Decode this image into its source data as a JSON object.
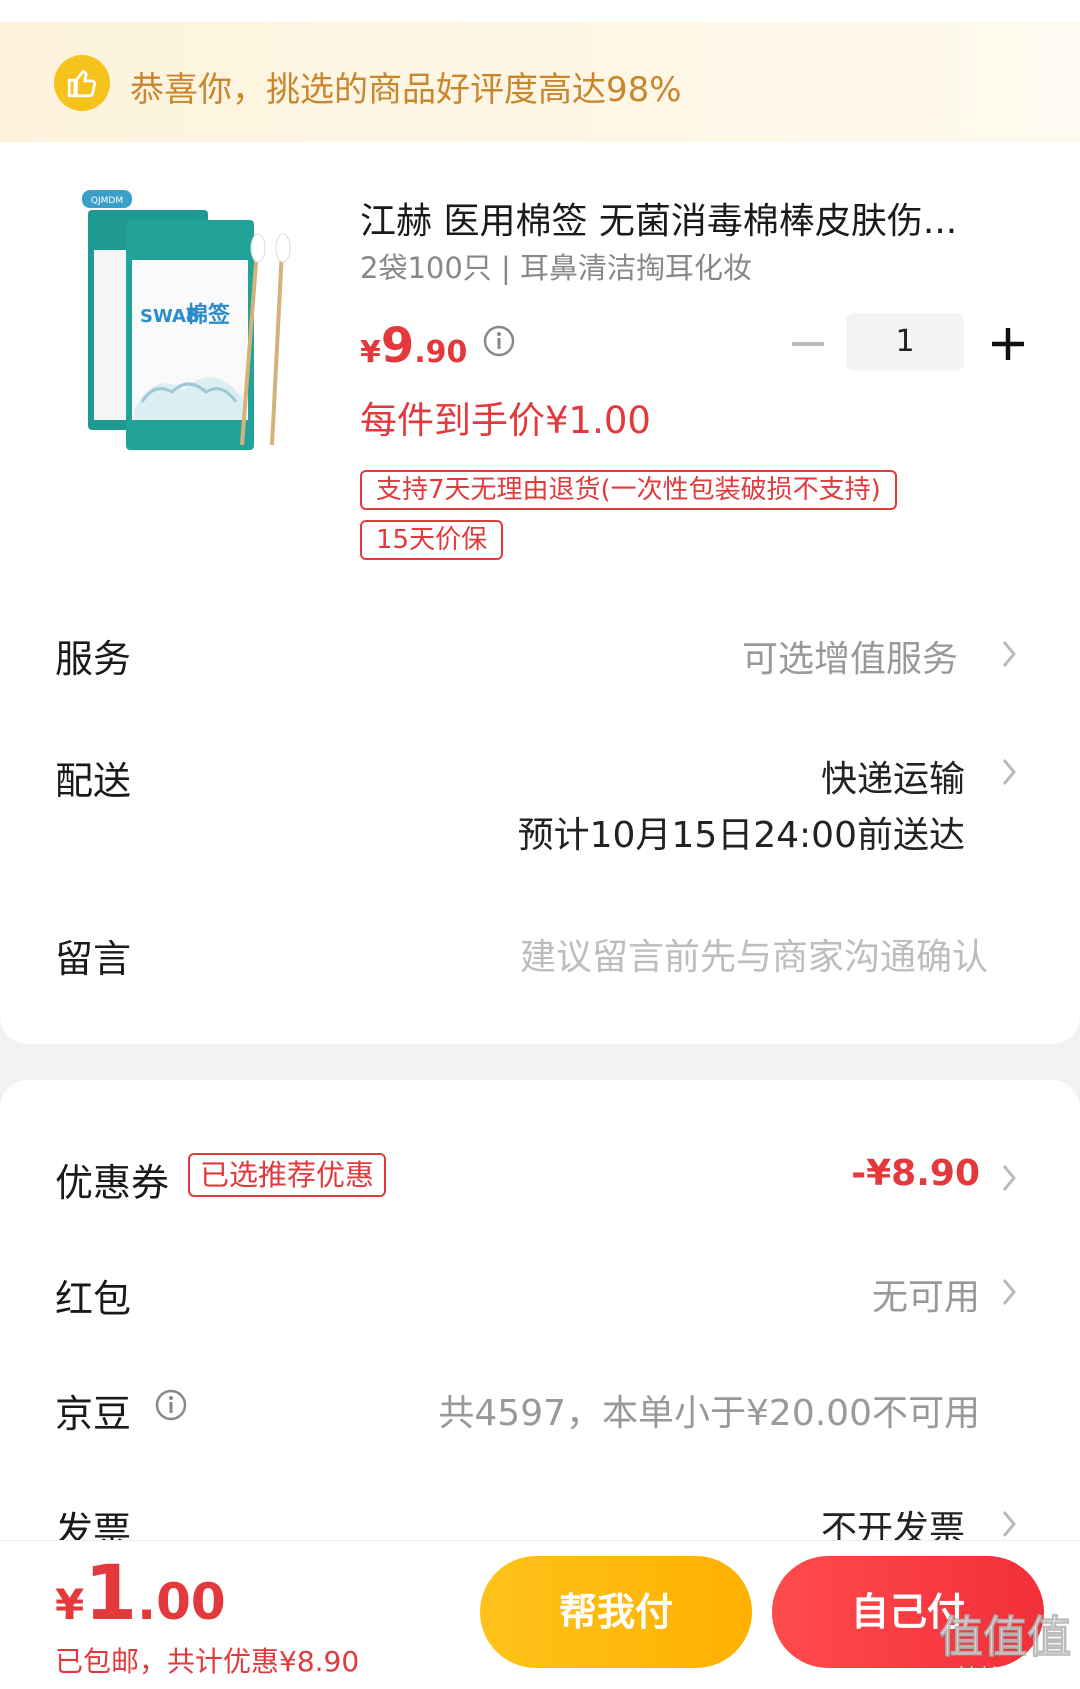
{
  "banner": {
    "text": "恭喜你，挑选的商品好评度高达98%",
    "icon": "thumbs-up-icon",
    "accent": "#f6c21c"
  },
  "product": {
    "title": "江赫 医用棉签 无菌消毒棉棒皮肤伤...",
    "spec": "2袋100只 | 耳鼻清洁掏耳化妆",
    "price": {
      "currency": "¥",
      "integer": "9",
      "decimal": ".90"
    },
    "unit_price": "每件到手价¥1.00",
    "quantity": "1",
    "tags": [
      "支持7天无理由退货(一次性包装破损不支持)",
      "15天价保"
    ],
    "image_brand": "QJMDM",
    "image_label_swab": "SWAB",
    "image_label_cn": "棉签"
  },
  "rows": {
    "service": {
      "label": "服务",
      "value": "可选增值服务"
    },
    "delivery": {
      "label": "配送",
      "value": "快递运输",
      "estimate": "预计10月15日24:00前送达"
    },
    "message": {
      "label": "留言",
      "placeholder": "建议留言前先与商家沟通确认"
    }
  },
  "discounts": {
    "coupon": {
      "label": "优惠券",
      "tag": "已选推荐优惠",
      "value": "-¥8.90"
    },
    "red_packet": {
      "label": "红包",
      "value": "无可用"
    },
    "jingdou": {
      "label": "京豆",
      "value": "共4597，本单小于¥20.00不可用"
    },
    "invoice": {
      "label": "发票",
      "value": "不开发票"
    }
  },
  "footer": {
    "total": {
      "currency": "¥",
      "integer": "1",
      "decimal": ".00"
    },
    "summary": "已包邮，共计优惠¥8.90",
    "help_pay": "帮我付",
    "self_pay": "自己付",
    "watermark": "值值值",
    "watermark_url": "zhizhizhi.com"
  },
  "colors": {
    "primary_red": "#e4393c",
    "pay_yellow": "#ffb000",
    "banner_text": "#c8872e"
  }
}
